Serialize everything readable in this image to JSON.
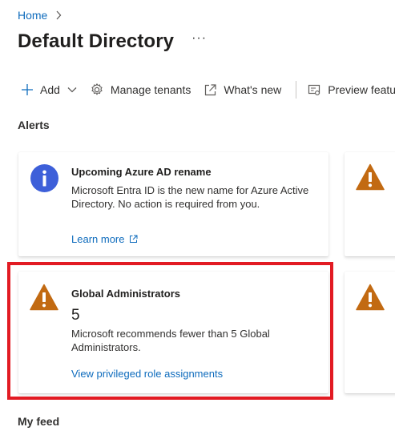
{
  "breadcrumb": {
    "home": "Home"
  },
  "header": {
    "title": "Default Directory",
    "more": "···"
  },
  "toolbar": {
    "add": "Add",
    "manage_tenants": "Manage tenants",
    "whats_new": "What's new",
    "preview_features": "Preview features"
  },
  "sections": {
    "alerts": "Alerts",
    "my_feed": "My feed"
  },
  "alerts": [
    {
      "title": "Upcoming Azure AD rename",
      "description": "Microsoft Entra ID is the new name for Azure Active Directory. No action is required from you.",
      "link": "Learn more",
      "icon": "info-icon"
    },
    {
      "title": "Global Administrators",
      "count": "5",
      "description": "Microsoft recommends fewer than 5 Global Administrators.",
      "link": "View privileged role assignments",
      "icon": "warning-icon"
    }
  ],
  "colors": {
    "accent": "#0f6cbd",
    "info": "#3d5fd9",
    "warning": "#c26a12",
    "highlight": "#e21b23"
  }
}
